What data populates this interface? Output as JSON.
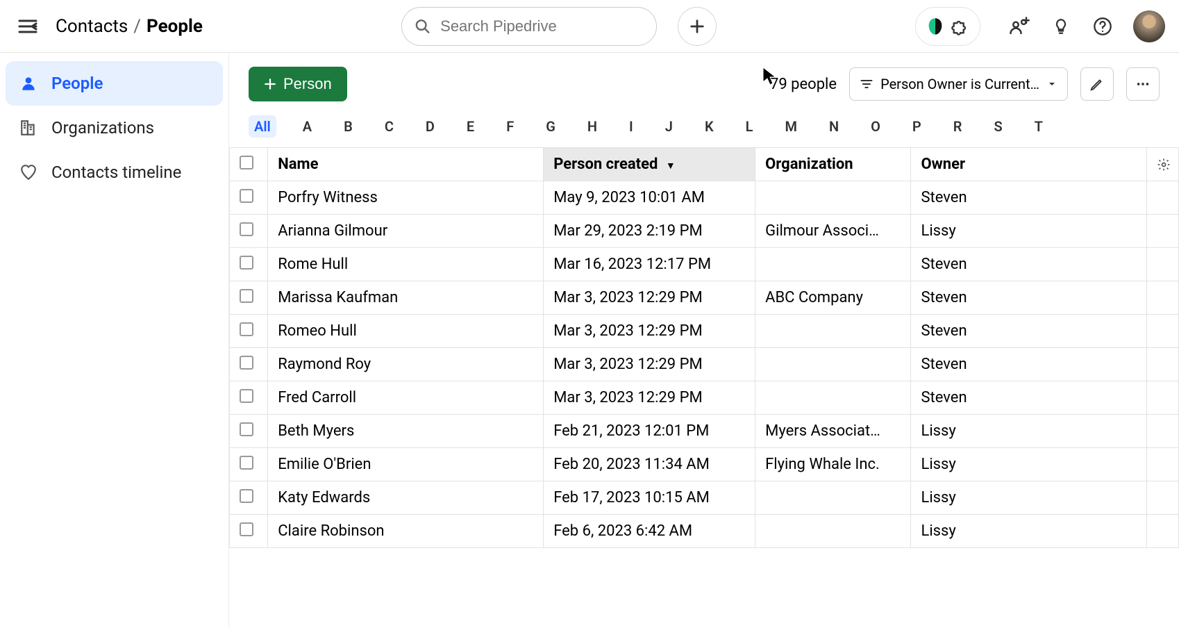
{
  "header": {
    "breadcrumb_root": "Contacts",
    "breadcrumb_current": "People",
    "search_placeholder": "Search Pipedrive"
  },
  "sidebar": {
    "items": [
      {
        "label": "People",
        "active": true
      },
      {
        "label": "Organizations",
        "active": false
      },
      {
        "label": "Contacts timeline",
        "active": false
      }
    ]
  },
  "toolbar": {
    "add_label": "Person",
    "count_text": "79 people",
    "filter_label": "Person Owner is Current…"
  },
  "alpha": {
    "all_label": "All",
    "letters": [
      "A",
      "B",
      "C",
      "D",
      "E",
      "F",
      "G",
      "H",
      "I",
      "J",
      "K",
      "L",
      "M",
      "N",
      "O",
      "P",
      "R",
      "S",
      "T"
    ]
  },
  "columns": {
    "name": "Name",
    "created": "Person created",
    "org": "Organization",
    "owner": "Owner"
  },
  "rows": [
    {
      "name": "Porfry Witness",
      "created": "May 9, 2023 10:01 AM",
      "org": "",
      "owner": "Steven"
    },
    {
      "name": "Arianna Gilmour",
      "created": "Mar 29, 2023 2:19 PM",
      "org": "Gilmour Associ…",
      "owner": "Lissy"
    },
    {
      "name": "Rome Hull",
      "created": "Mar 16, 2023 12:17 PM",
      "org": "",
      "owner": "Steven"
    },
    {
      "name": "Marissa Kaufman",
      "created": "Mar 3, 2023 12:29 PM",
      "org": "ABC Company",
      "owner": "Steven"
    },
    {
      "name": "Romeo Hull",
      "created": "Mar 3, 2023 12:29 PM",
      "org": "",
      "owner": "Steven"
    },
    {
      "name": "Raymond Roy",
      "created": "Mar 3, 2023 12:29 PM",
      "org": "",
      "owner": "Steven"
    },
    {
      "name": "Fred Carroll",
      "created": "Mar 3, 2023 12:29 PM",
      "org": "",
      "owner": "Steven"
    },
    {
      "name": "Beth Myers",
      "created": "Feb 21, 2023 12:01 PM",
      "org": "Myers Associat…",
      "owner": "Lissy"
    },
    {
      "name": "Emilie O'Brien",
      "created": "Feb 20, 2023 11:34 AM",
      "org": "Flying Whale Inc.",
      "owner": "Lissy"
    },
    {
      "name": "Katy Edwards",
      "created": "Feb 17, 2023 10:15 AM",
      "org": "",
      "owner": "Lissy"
    },
    {
      "name": "Claire Robinson",
      "created": "Feb 6, 2023 6:42 AM",
      "org": "",
      "owner": "Lissy"
    }
  ],
  "colors": {
    "primary_green": "#1c7a3e",
    "accent_blue": "#1a5cff",
    "highlight_bg": "#e6f0ff"
  }
}
